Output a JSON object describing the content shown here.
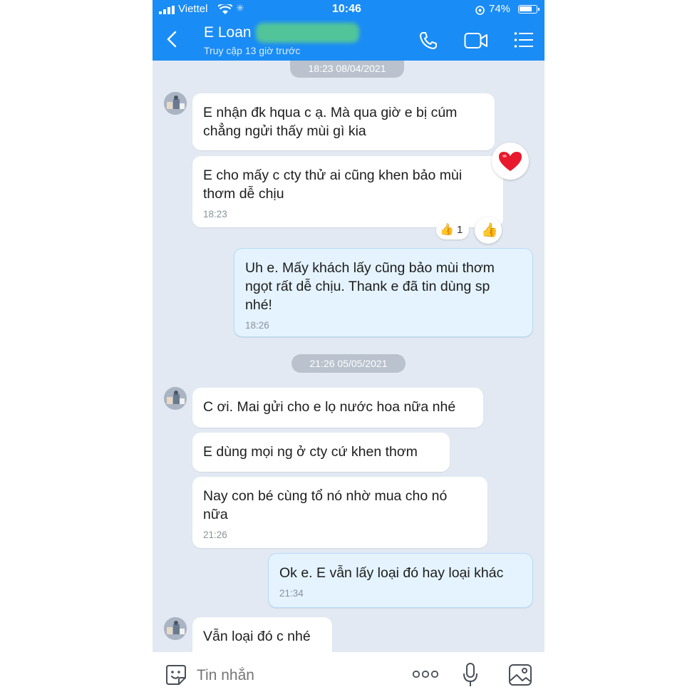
{
  "status_bar": {
    "carrier": "Viettel",
    "time": "10:46",
    "battery": "74%"
  },
  "header": {
    "contact_name": "E Loan",
    "last_seen": "Truy cập 13 giờ trước",
    "icons": [
      "back-icon",
      "phone-icon",
      "video-call-icon",
      "menu-list-icon"
    ]
  },
  "chat": {
    "date_separators": [
      "18:23 08/04/2021",
      "21:26 05/05/2021"
    ],
    "messages": [
      {
        "from": "contact",
        "text": "E nhận đk hqua c ạ. Mà qua giờ e bị cúm\nchẳng ngửi thấy mùi gì kia",
        "time": ""
      },
      {
        "from": "contact",
        "text": "E cho mấy c cty thử ai cũng khen bảo mùi\nthơm dễ chịu",
        "time": "18:23",
        "reaction": "heart",
        "reaction_count": "1"
      },
      {
        "from": "me",
        "text": "Uh e. Mấy khách lấy cũng bảo mùi thơm\nngọt rất dễ chịu. Thank e đã tin dùng sp\nnhé!",
        "time": "18:26"
      },
      {
        "from": "contact",
        "text": "C ơi. Mai gửi cho e lọ nước hoa nữa nhé",
        "time": ""
      },
      {
        "from": "contact",
        "text": "E dùng mọi ng ở cty cứ khen thơm",
        "time": ""
      },
      {
        "from": "contact",
        "text": "Nay con bé cùng tổ nó nhờ mua cho nó\nnữa",
        "time": "21:26"
      },
      {
        "from": "me",
        "text": "Ok e. E vẫn lấy loại đó hay loại khác",
        "time": "21:34"
      },
      {
        "from": "contact",
        "text": "Vẫn loại đó c nhé",
        "time": ""
      }
    ]
  },
  "input_bar": {
    "placeholder": "Tin nhắn",
    "icons": [
      "sticker-icon",
      "more-options-icon",
      "microphone-icon",
      "image-icon"
    ]
  },
  "colors": {
    "header": "#1a8cf5",
    "chat_background": "#e2e9f3",
    "outgoing_bubble": "#e4f3fe",
    "incoming_bubble": "#ffffff",
    "heart": "#e8192c"
  }
}
